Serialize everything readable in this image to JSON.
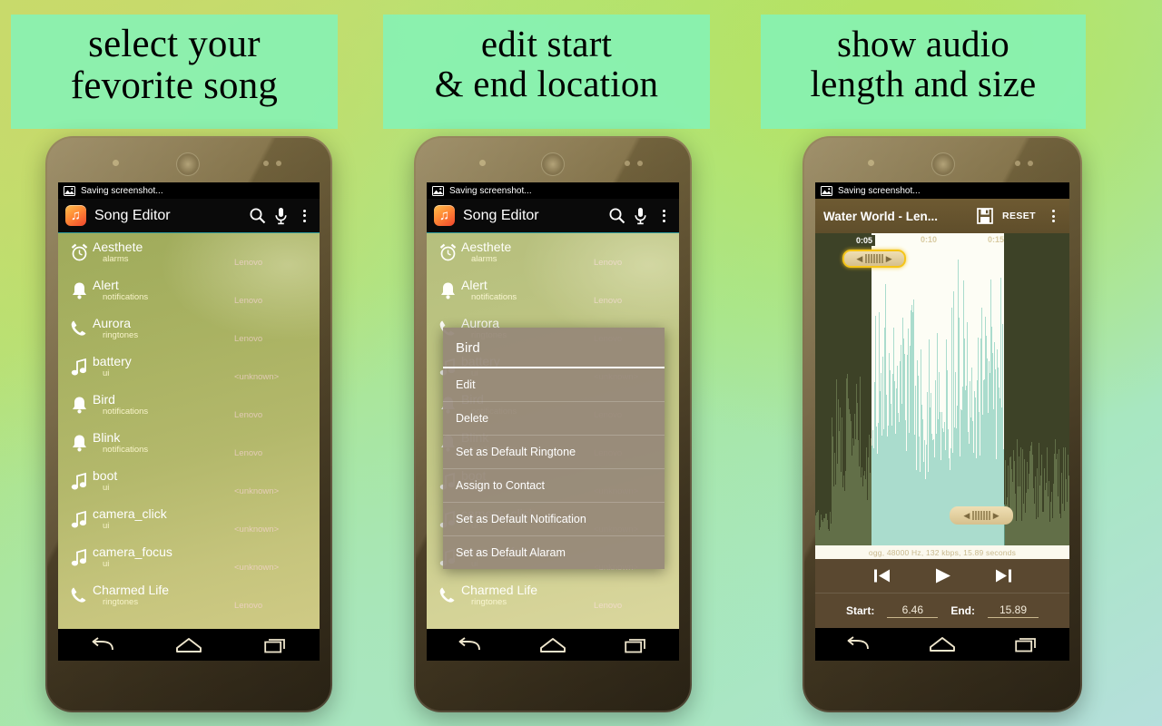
{
  "captions": [
    {
      "line1": "select your",
      "line2": "fevorite song"
    },
    {
      "line1": "edit start",
      "line2": "& end location"
    },
    {
      "line1": "show audio",
      "line2": "length and size"
    }
  ],
  "colors": {
    "caption_bg": "#82f3b9",
    "app_accent": "#ff8a35",
    "handle_highlight": "#f5c518",
    "waveform": "#9fd8c8",
    "editor_bar": "#5f4e2b"
  },
  "status_bar": {
    "text": "Saving screenshot...",
    "icon": "image-icon"
  },
  "app_bar": {
    "title": "Song Editor",
    "icon": "music-note-app-icon",
    "actions": [
      {
        "name": "search-icon",
        "label": "Search"
      },
      {
        "name": "microphone-icon",
        "label": "Voice search"
      },
      {
        "name": "overflow-menu-icon",
        "label": "More options"
      }
    ]
  },
  "nav_bar": {
    "back": "back-icon",
    "home": "home-icon",
    "recents": "recents-icon"
  },
  "ringtone_list": [
    {
      "title": "Aesthete",
      "category": "alarms",
      "artist": "Lenovo",
      "icon": "alarm-icon"
    },
    {
      "title": "Alert",
      "category": "notifications",
      "artist": "Lenovo",
      "icon": "bell-icon"
    },
    {
      "title": "Aurora",
      "category": "ringtones",
      "artist": "Lenovo",
      "icon": "phone-icon"
    },
    {
      "title": "battery",
      "category": "ui",
      "artist": "<unknown>",
      "icon": "music-note-icon"
    },
    {
      "title": "Bird",
      "category": "notifications",
      "artist": "Lenovo",
      "icon": "bell-icon"
    },
    {
      "title": "Blink",
      "category": "notifications",
      "artist": "Lenovo",
      "icon": "bell-icon"
    },
    {
      "title": "boot",
      "category": "ui",
      "artist": "<unknown>",
      "icon": "music-note-icon"
    },
    {
      "title": "camera_click",
      "category": "ui",
      "artist": "<unknown>",
      "icon": "music-note-icon"
    },
    {
      "title": "camera_focus",
      "category": "ui",
      "artist": "<unknown>",
      "icon": "music-note-icon"
    },
    {
      "title": "Charmed Life",
      "category": "ringtones",
      "artist": "Lenovo",
      "icon": "phone-icon"
    }
  ],
  "context_menu": {
    "title": "Bird",
    "items": [
      "Edit",
      "Delete",
      "Set as Default Ringtone",
      "Assign to Contact",
      "Set as Default Notification",
      "Set as Default Alaram"
    ]
  },
  "editor": {
    "title": "Water World - Len...",
    "save_icon": "save-floppy-icon",
    "reset_label": "RESET",
    "overflow_icon": "overflow-menu-icon",
    "time_labels": [
      "0:05",
      "0:10",
      "0:15"
    ],
    "info": "ogg, 48000 Hz, 132 kbps, 15.89 seconds",
    "transport": [
      {
        "name": "skip-previous-icon",
        "label": "Skip to start"
      },
      {
        "name": "play-icon",
        "label": "Play"
      },
      {
        "name": "skip-next-icon",
        "label": "Skip to end"
      }
    ],
    "start_label": "Start:",
    "start_value": "6.46",
    "end_label": "End:",
    "end_value": "15.89"
  }
}
